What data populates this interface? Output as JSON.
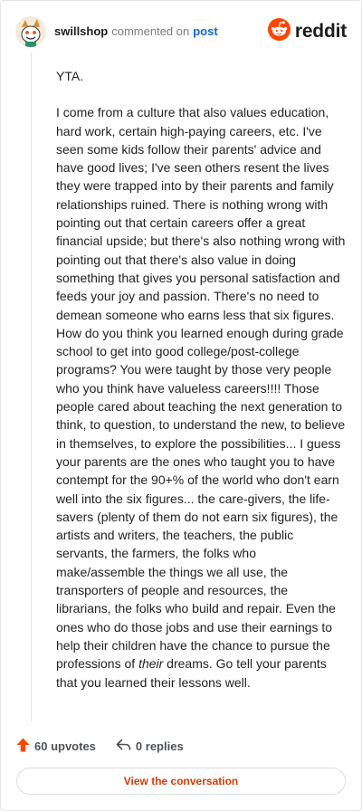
{
  "header": {
    "username": "swillshop",
    "action_text": "commented on",
    "post_link": "post",
    "brand": "reddit"
  },
  "comment": {
    "paragraph1": "YTA.",
    "paragraph2_before_em": "I come from a culture that also values education, hard work, certain high-paying careers, etc. I've seen some kids follow their parents' advice and have good lives; I've seen others resent the lives they were trapped into by their parents and family relationships ruined. There is nothing wrong with pointing out that certain careers offer a great financial upside; but there's also nothing wrong with pointing out that there's also value in doing something that gives you personal satisfaction and feeds your joy and passion. There's no need to demean someone who earns less that six figures. How do you think you learned enough during grade school to get into good college/post-college programs? You were taught by those very people who you think have valueless careers!!!! Those people cared about teaching the next generation to think, to question, to understand the new, to believe in themselves, to explore the possibilities... I guess your parents are the ones who taught you to have contempt for the 90+% of the world who don't earn well into the six figures... the care-givers, the life-savers (plenty of them do not earn six figures), the artists and writers, the teachers, the public servants, the farmers, the folks who make/assemble the things we all use, the transporters of people and resources, the librarians, the folks who build and repair. Even the ones who do those jobs and use their earnings to help their children have the chance to pursue the professions of ",
    "paragraph2_em": "their",
    "paragraph2_after_em": " dreams. Go tell your parents that you learned their lessons well."
  },
  "footer": {
    "upvotes": "60 upvotes",
    "replies": "0 replies",
    "view_button": "View the conversation"
  },
  "icons": {
    "avatar": "avatar-snoo",
    "brand": "reddit-logo-icon",
    "upvote": "upvote-arrow-icon",
    "reply": "reply-arrow-icon"
  },
  "colors": {
    "reddit_orange": "#ff4500",
    "link_blue": "#0f66c8",
    "button_text": "#d93a00"
  }
}
